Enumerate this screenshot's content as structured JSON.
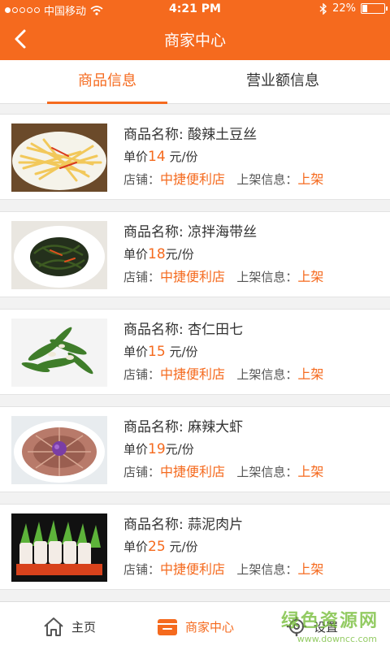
{
  "status": {
    "carrier": "中国移动",
    "time": "4:21 PM",
    "battery": "22%",
    "battery_level": 0.22
  },
  "header": {
    "title": "商家中心"
  },
  "tabs": [
    {
      "label": "商品信息",
      "active": true
    },
    {
      "label": "营业额信息",
      "active": false
    }
  ],
  "labels": {
    "name": "商品名称: ",
    "price": "单价",
    "unit": "元/份",
    "shop": "店铺：",
    "status": "上架信息："
  },
  "products": [
    {
      "name": "酸辣土豆丝",
      "price": "14",
      "shop": "中捷便利店",
      "status": "上架"
    },
    {
      "name": "凉拌海带丝",
      "price": "18",
      "shop": "中捷便利店",
      "status": "上架"
    },
    {
      "name": "杏仁田七",
      "price": "15",
      "shop": "中捷便利店",
      "status": "上架"
    },
    {
      "name": "麻辣大虾",
      "price": "19",
      "shop": "中捷便利店",
      "status": "上架"
    },
    {
      "name": "蒜泥肉片",
      "price": "25",
      "shop": "中捷便利店",
      "status": "上架"
    }
  ],
  "bottom_nav": [
    {
      "label": "主页"
    },
    {
      "label": "商家中心"
    },
    {
      "label": "设置"
    }
  ],
  "watermark": {
    "line1": "绿色资源网",
    "line2": "www.downcc.com"
  },
  "colors": {
    "accent": "#f56a1e"
  }
}
